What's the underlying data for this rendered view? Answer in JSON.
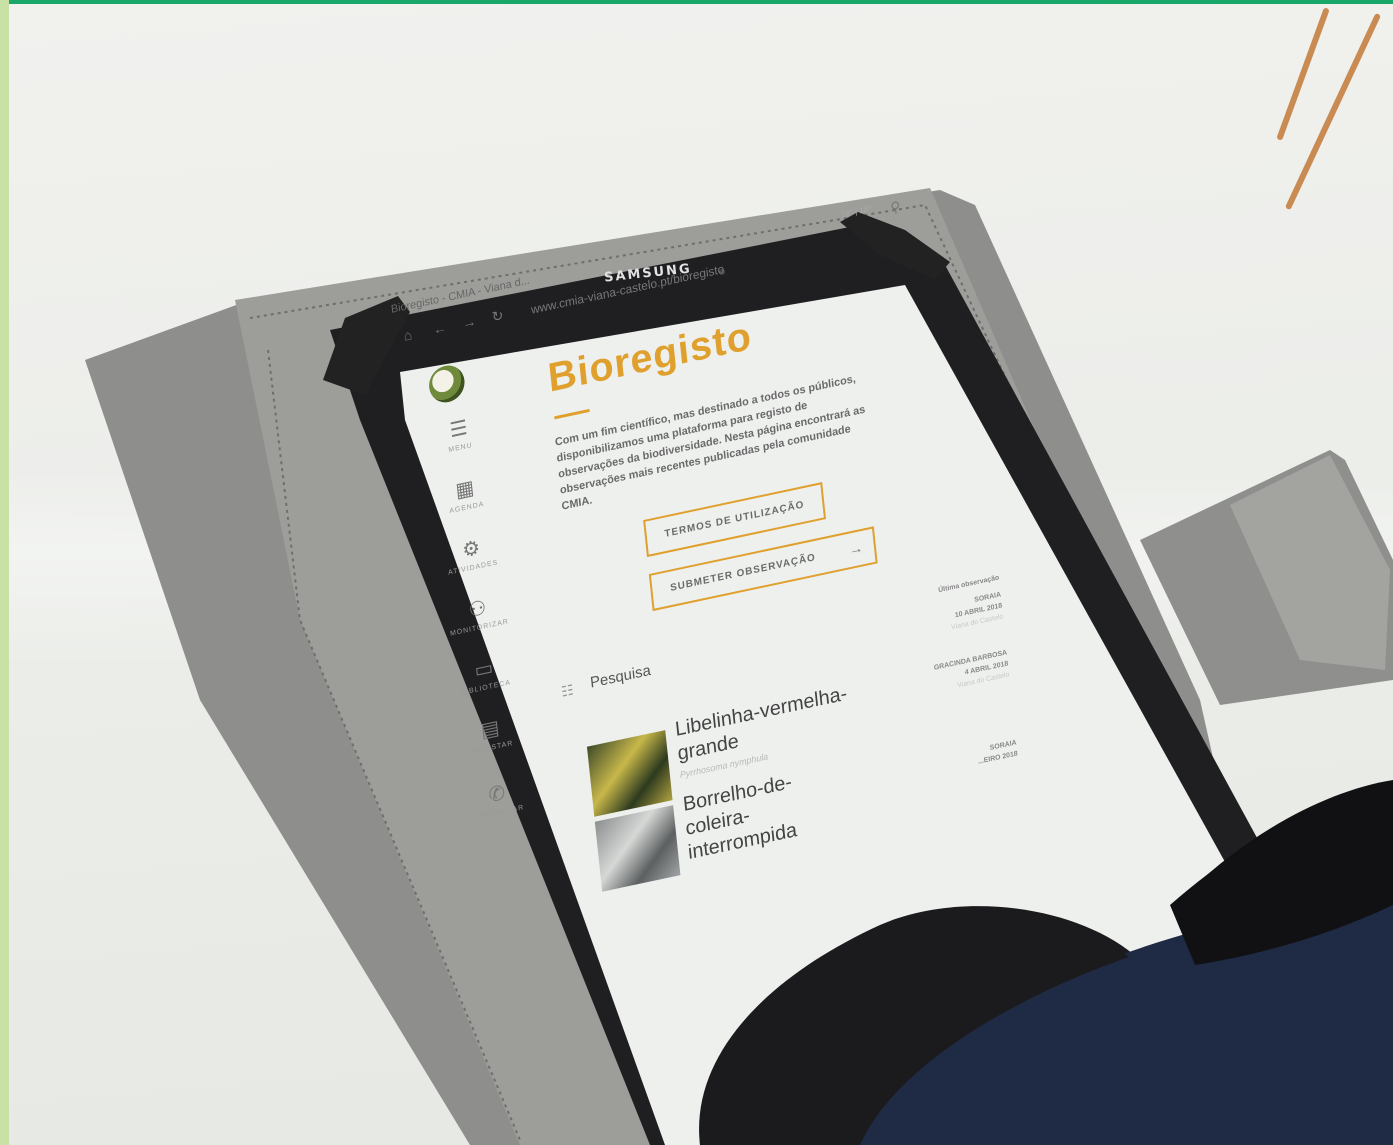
{
  "device": {
    "brand": "SAMSUNG"
  },
  "browser": {
    "tab_title": "Bioregisto - CMIA - Viana d...",
    "url": "www.cmia-viana-castelo.pt/bioregisto",
    "weather": "19° | 16°"
  },
  "sidebar": {
    "items": [
      {
        "label": "MENU",
        "icon": "menu-icon"
      },
      {
        "label": "AGENDA",
        "icon": "calendar-icon"
      },
      {
        "label": "ATIVIDADES",
        "icon": "gear-icon"
      },
      {
        "label": "MONITORIZAR",
        "icon": "binoculars-icon"
      },
      {
        "label": "BIBLIOTECA",
        "icon": "book-icon"
      },
      {
        "label": "REGISTAR",
        "icon": "clipboard-icon"
      },
      {
        "label": "CONTACTAR",
        "icon": "phone-icon"
      }
    ]
  },
  "page": {
    "title": "Bioregisto",
    "intro": "Com um fim científico, mas destinado a todos os públicos, disponibilizamos uma plataforma para registo de observações da biodiversidade. Nesta página encontrará as observações mais recentes publicadas pela comunidade CMIA.",
    "terms_button": "TERMOS DE UTILIZAÇÃO",
    "submit_button": "SUBMETER OBSERVAÇÃO",
    "search_label": "Pesquisa"
  },
  "species": [
    {
      "name": "Libelinha-vermelha-grande",
      "scientific": "Pyrrhosoma nymphula"
    },
    {
      "name": "Borrelho-de-coleira-interrompida",
      "scientific": ""
    }
  ],
  "observations": {
    "header": "Última observação",
    "items": [
      {
        "observer": "SORAIA",
        "date": "10 ABRIL 2018",
        "place": "Viana do Castelo"
      },
      {
        "observer": "GRACINDA BARBOSA",
        "date": "4 ABRIL 2018",
        "place": "Viana do Castelo"
      },
      {
        "observer": "SORAIA",
        "date": "...EIRO 2018",
        "place": ""
      }
    ]
  }
}
